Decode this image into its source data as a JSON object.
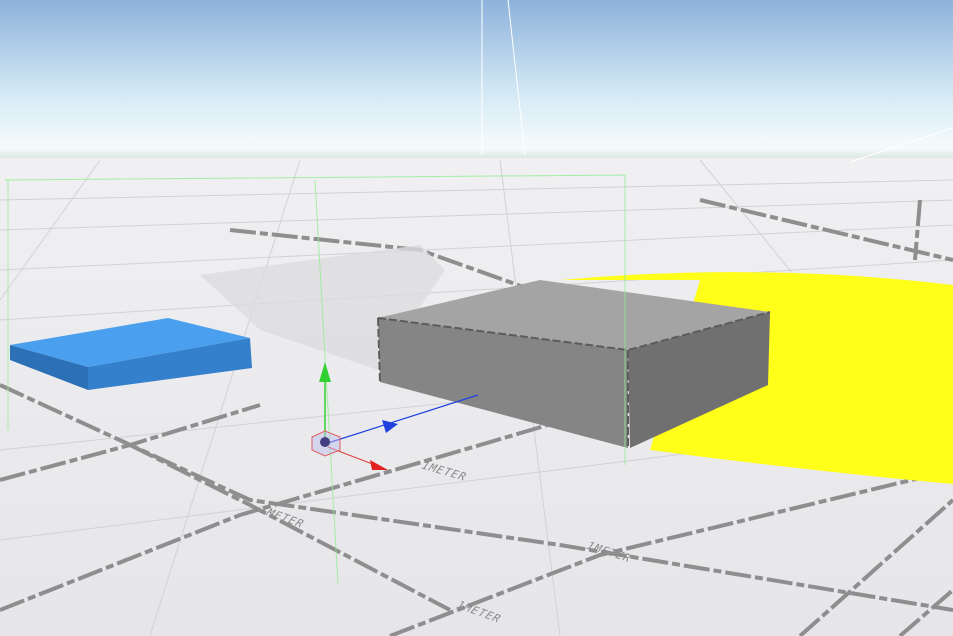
{
  "scene": {
    "grid_labels": [
      "1METER",
      "1METER",
      "1METER",
      "1METER"
    ],
    "colors": {
      "sky_top": "#8fb4de",
      "sky_horizon": "#f4fafc",
      "ground": "#ebebef",
      "grid_major": "#8a8a8a",
      "blue_box": "#4aa0ee",
      "gray_box": "#8c8c8c",
      "yellow_plane": "#ffff1a",
      "axis_x": "#e02020",
      "axis_y": "#30d030",
      "axis_z": "#2040e0"
    }
  }
}
